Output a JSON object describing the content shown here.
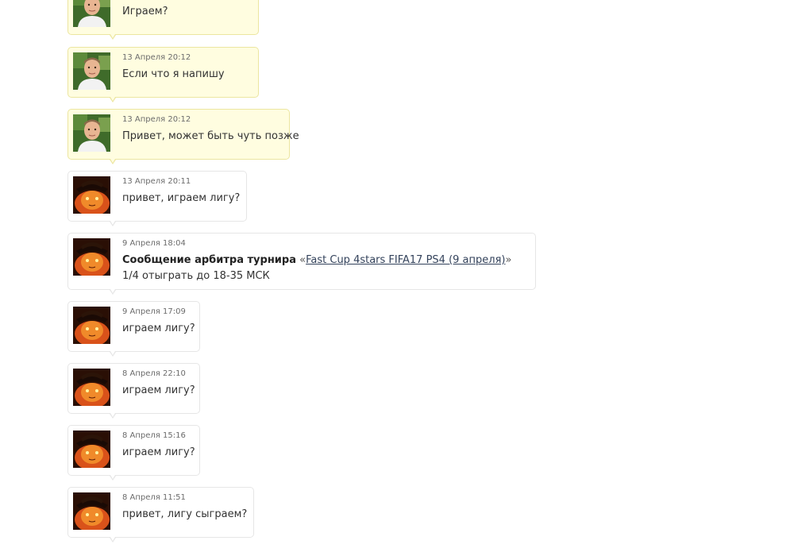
{
  "messages": [
    {
      "id": 0,
      "sender": "opponent",
      "avatar": "man-photo-avatar",
      "time": "",
      "text": "Играем?"
    },
    {
      "id": 1,
      "sender": "opponent",
      "avatar": "man-photo-avatar",
      "time": "13 Апреля 20:12",
      "text": "Если что я напишу"
    },
    {
      "id": 2,
      "sender": "opponent",
      "avatar": "man-photo-avatar",
      "time": "13 Апреля 20:12",
      "text": "Привет, может быть чуть позже"
    },
    {
      "id": 3,
      "sender": "me",
      "avatar": "puss-in-boots-avatar",
      "time": "13 Апреля 20:11",
      "text": "привет, играем лигу?"
    },
    {
      "id": 4,
      "sender": "me",
      "avatar": "puss-in-boots-avatar",
      "time": "9 Апреля 18:04",
      "arbiter_prefix": "Сообщение арбитра турнира",
      "quote_open": "«",
      "tournament_link": "Fast Cup 4stars FIFA17 PS4 (9 апреля)",
      "quote_close": "»",
      "text": "1/4 отыграть до 18-35 МСК"
    },
    {
      "id": 5,
      "sender": "me",
      "avatar": "puss-in-boots-avatar",
      "time": "9 Апреля 17:09",
      "text": "играем лигу?"
    },
    {
      "id": 6,
      "sender": "me",
      "avatar": "puss-in-boots-avatar",
      "time": "8 Апреля 22:10",
      "text": "играем лигу?"
    },
    {
      "id": 7,
      "sender": "me",
      "avatar": "puss-in-boots-avatar",
      "time": "8 Апреля 15:16",
      "text": "играем лигу?"
    },
    {
      "id": 8,
      "sender": "me",
      "avatar": "puss-in-boots-avatar",
      "time": "8 Апреля 11:51",
      "text": "привет, лигу сыграем?"
    }
  ]
}
